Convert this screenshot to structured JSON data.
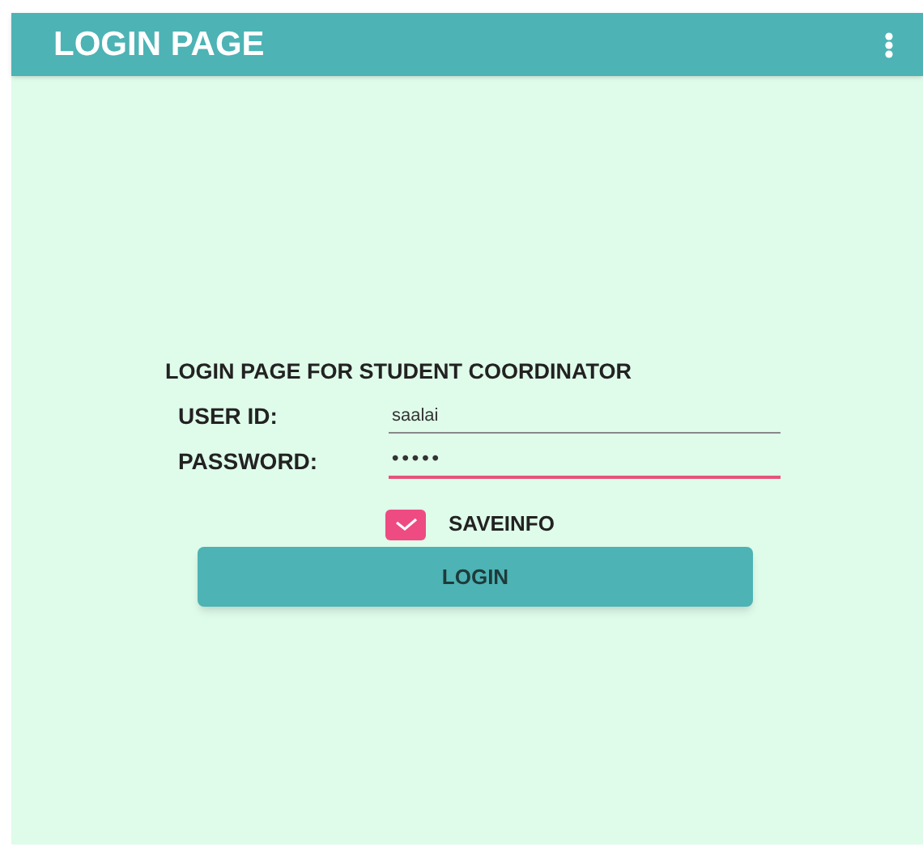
{
  "app_bar": {
    "title": "LOGIN PAGE"
  },
  "form": {
    "heading": "LOGIN PAGE FOR STUDENT COORDINATOR",
    "fields": [
      {
        "label": "USER ID:",
        "value": "saalai",
        "focused": false
      },
      {
        "label": "PASSWORD:",
        "value": "•••••",
        "focused": true
      }
    ],
    "save_info": {
      "label": "SAVEINFO",
      "checked": true
    },
    "button": "LOGIN"
  }
}
